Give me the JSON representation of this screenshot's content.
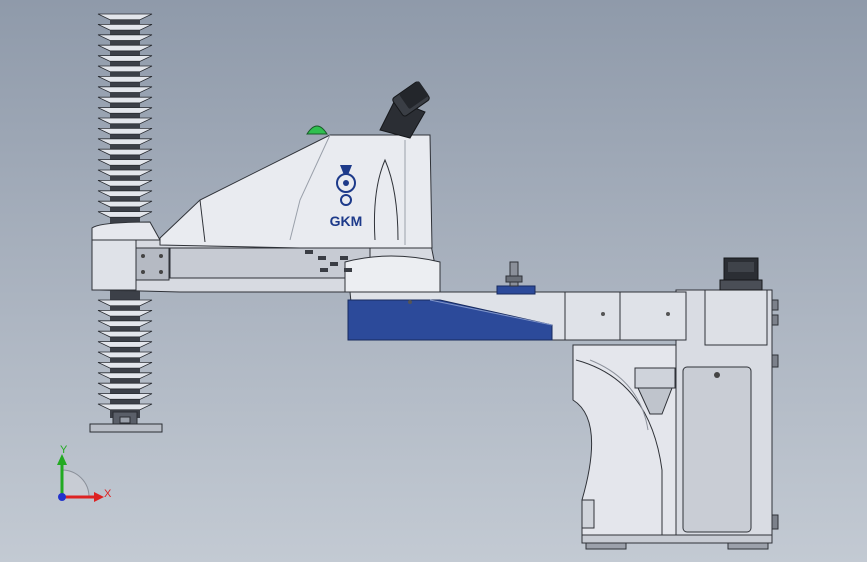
{
  "scene": {
    "brand_logo": "GKM",
    "colors": {
      "background_top": "#8f9aaa",
      "background_bottom": "#c3cad3",
      "body_light": "#e6e8ee",
      "body_mid": "#cfd3db",
      "accent_blue": "#2c4a9a",
      "edge": "#3a3d44",
      "indicator_green": "#2fbf4f"
    }
  },
  "axes": {
    "y_label": "Y",
    "x_label": "X",
    "y_color": "#22aa22",
    "x_color": "#dd2222",
    "z_color": "#2233cc"
  }
}
